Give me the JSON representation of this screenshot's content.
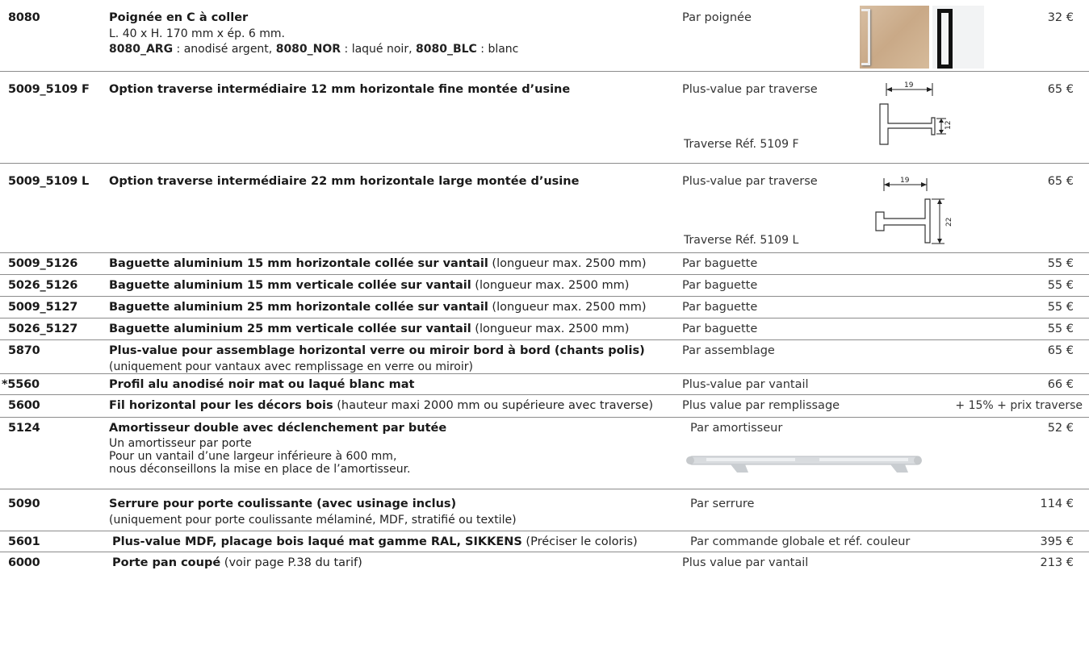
{
  "rows": [
    {
      "ref": "8080",
      "title": "Poignée en C à coller",
      "line1": "L. 40 x H. 170 mm x ép. 6 mm.",
      "opt1_code": "8080_ARG",
      "opt1_text": " : anodisé argent, ",
      "opt2_code": "8080_NOR",
      "opt2_text": " : laqué noir, ",
      "opt3_code": "8080_BLC",
      "opt3_text": " :  blanc",
      "unit": "Par poignée",
      "price": "32 €"
    },
    {
      "ref": "5009_5109 F",
      "title": "Option traverse intermédiaire 12 mm horizontale fine montée d’usine",
      "unit": "Plus-value par traverse",
      "unit2": "Traverse Réf. 5109 F",
      "price": "65 €",
      "dim_w": "19",
      "dim_h": "12"
    },
    {
      "ref": "5009_5109 L",
      "title": "Option traverse intermédiaire 22 mm horizontale large montée d’usine",
      "unit": "Plus-value par traverse",
      "unit2": "Traverse Réf. 5109 L",
      "price": "65 €",
      "dim_w": "19",
      "dim_h": "22"
    },
    {
      "ref": "5009_5126",
      "title": "Baguette aluminium 15 mm horizontale collée sur vantail",
      "sub": " (longueur max. 2500 mm)",
      "unit": "Par baguette",
      "price": "55 €"
    },
    {
      "ref": "5026_5126",
      "title": "Baguette aluminium 15 mm verticale collée sur vantail",
      "sub": " (longueur max. 2500 mm)",
      "unit": "Par baguette",
      "price": "55 €"
    },
    {
      "ref": "5009_5127",
      "title": "Baguette aluminium 25 mm horizontale collée sur vantail",
      "sub": " (longueur max. 2500 mm)",
      "unit": "Par baguette",
      "price": "55 €"
    },
    {
      "ref": "5026_5127",
      "title": "Baguette aluminium 25 mm verticale collée sur vantail",
      "sub": " (longueur max. 2500 mm)",
      "unit": "Par baguette",
      "price": "55 €"
    },
    {
      "ref": "5870",
      "title": "Plus-value pour assemblage horizontal verre ou miroir bord à bord (chants polis)",
      "line1": "(uniquement pour vantaux avec remplissage en verre ou miroir)",
      "unit": "Par assemblage",
      "price": "65 €"
    },
    {
      "ref": "*5560",
      "title": "Profil alu anodisé noir mat ou laqué blanc mat",
      "unit": "Plus-value par vantail",
      "price": "66 €"
    },
    {
      "ref": "5600",
      "title": "Fil horizontal pour les décors bois",
      "sub": " (hauteur maxi 2000 mm ou supérieure avec traverse)",
      "unit": "Plus value par remplissage",
      "price": "+ 15% + prix traverse"
    },
    {
      "ref": "5124",
      "title": "Amortisseur double avec déclenchement par butée",
      "line1": "Un amortisseur par porte",
      "line2": "Pour un vantail d’une largeur inférieure à 600 mm,",
      "line3": "nous déconseillons la mise en place de l’amortisseur.",
      "unit": "Par amortisseur",
      "price": "52 €"
    },
    {
      "ref": "5090",
      "title": "Serrure pour porte coulissante (avec usinage inclus)",
      "line1": "(uniquement pour porte coulissante mélaminé, MDF, stratifié ou textile)",
      "unit": "Par serrure",
      "price": "114 €"
    },
    {
      "ref": "5601",
      "title": "Plus-value MDF, placage bois laqué mat gamme RAL, SIKKENS",
      "sub": " (Préciser le coloris)",
      "unit": "Par commande globale et réf. couleur",
      "price": "395 €"
    },
    {
      "ref": "6000",
      "title": "Porte pan coupé",
      "sub": " (voir page P.38 du tarif)",
      "unit": "Plus value par vantail",
      "price": "213 €"
    }
  ]
}
